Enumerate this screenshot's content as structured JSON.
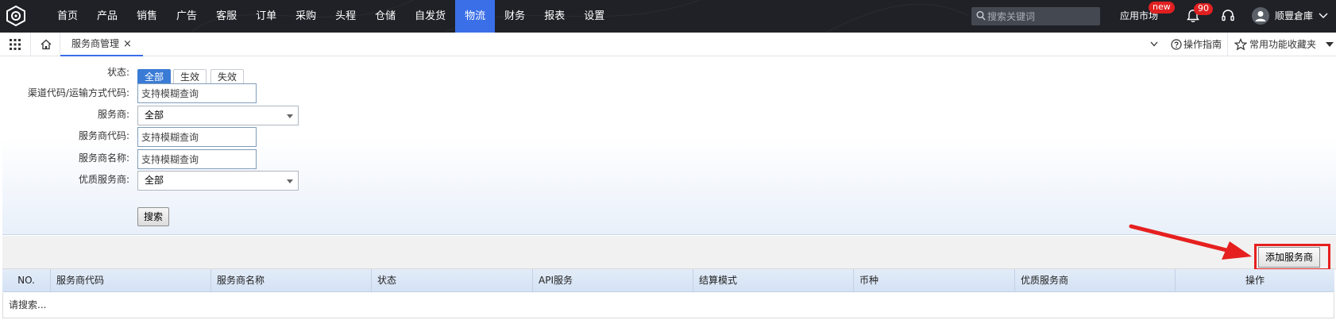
{
  "topnav": {
    "items": [
      {
        "label": "首页",
        "active": false
      },
      {
        "label": "产品",
        "active": false
      },
      {
        "label": "销售",
        "active": false
      },
      {
        "label": "广告",
        "active": false
      },
      {
        "label": "客服",
        "active": false
      },
      {
        "label": "订单",
        "active": false
      },
      {
        "label": "采购",
        "active": false
      },
      {
        "label": "头程",
        "active": false
      },
      {
        "label": "仓储",
        "active": false
      },
      {
        "label": "自发货",
        "active": false
      },
      {
        "label": "物流",
        "active": true
      },
      {
        "label": "财务",
        "active": false
      },
      {
        "label": "报表",
        "active": false
      },
      {
        "label": "设置",
        "active": false
      }
    ],
    "search_placeholder": "搜索关键词",
    "app_market": "应用市场",
    "new_badge": "new",
    "notification_count": "90",
    "user_name": "顺豐倉庫"
  },
  "tabbar": {
    "tab_label": "服务商管理",
    "tab_close": "×",
    "help_label": "操作指南",
    "favorites_label": "常用功能收藏夹"
  },
  "filters": {
    "status_label": "状态:",
    "status_options": [
      "全部",
      "生效",
      "失效"
    ],
    "status_selected": "全部",
    "channel_code_label": "渠道代码/运输方式代码:",
    "channel_code_placeholder": "支持模糊查询",
    "provider_label": "服务商:",
    "provider_value": "全部",
    "provider_code_label": "服务商代码:",
    "provider_code_placeholder": "支持模糊查询",
    "provider_name_label": "服务商名称:",
    "provider_name_placeholder": "支持模糊查询",
    "quality_provider_label": "优质服务商:",
    "quality_provider_value": "全部",
    "search_button": "搜索"
  },
  "actions": {
    "add_provider_button": "添加服务商"
  },
  "table": {
    "columns": [
      "NO.",
      "服务商代码",
      "服务商名称",
      "状态",
      "API服务",
      "结算模式",
      "币种",
      "优质服务商",
      "操作"
    ],
    "empty_text": "请搜索..."
  },
  "colors": {
    "nav_bg": "#1f2127",
    "nav_active": "#3a6fe8",
    "badge_red": "#e02020",
    "highlight_red": "#e6201f",
    "table_header": "#d4e2f4"
  }
}
